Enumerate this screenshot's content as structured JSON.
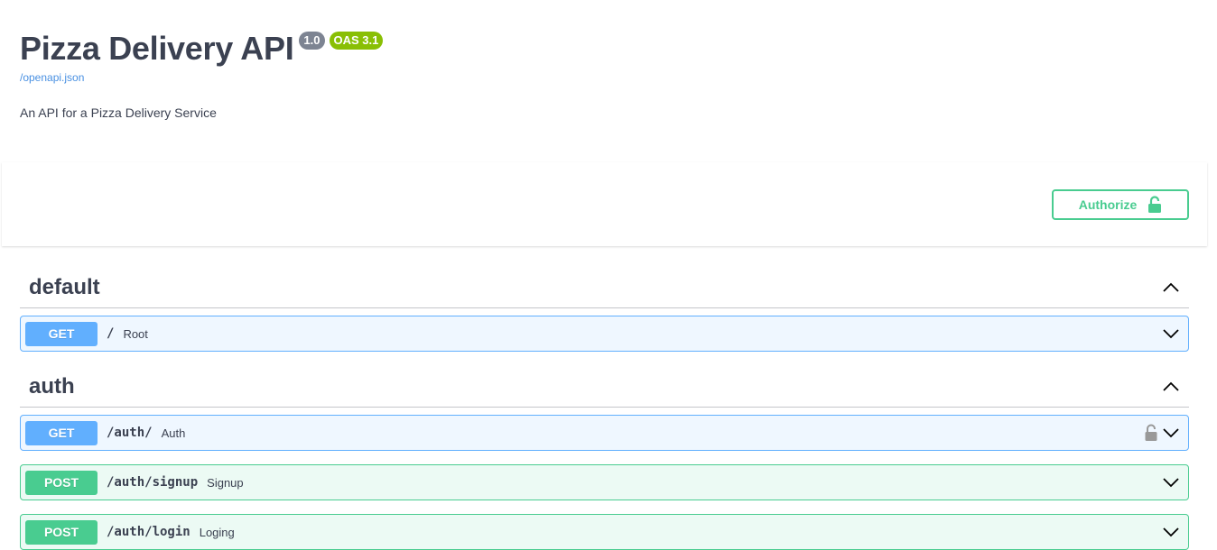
{
  "info": {
    "title": "Pizza Delivery API",
    "version": "1.0",
    "oas_version": "OAS 3.1",
    "spec_link": "/openapi.json",
    "description": "An API for a Pizza Delivery Service"
  },
  "scheme": {
    "authorize_label": "Authorize",
    "lock_icon": "unlocked-lock-icon"
  },
  "tags": [
    {
      "name": "default",
      "operations": [
        {
          "method": "GET",
          "path": "/",
          "summary": "Root"
        }
      ]
    },
    {
      "name": "auth",
      "operations": [
        {
          "method": "GET",
          "path": "/auth/",
          "summary": "Auth",
          "locked_icon": true
        },
        {
          "method": "POST",
          "path": "/auth/signup",
          "summary": "Signup"
        },
        {
          "method": "POST",
          "path": "/auth/login",
          "summary": "Loging"
        }
      ]
    }
  ],
  "colors": {
    "get": "#61affe",
    "post": "#49cc90",
    "authorize": "#49cc90",
    "version_badge": "#7d8492",
    "oas_badge": "#89bf04",
    "link": "#4990e2"
  }
}
